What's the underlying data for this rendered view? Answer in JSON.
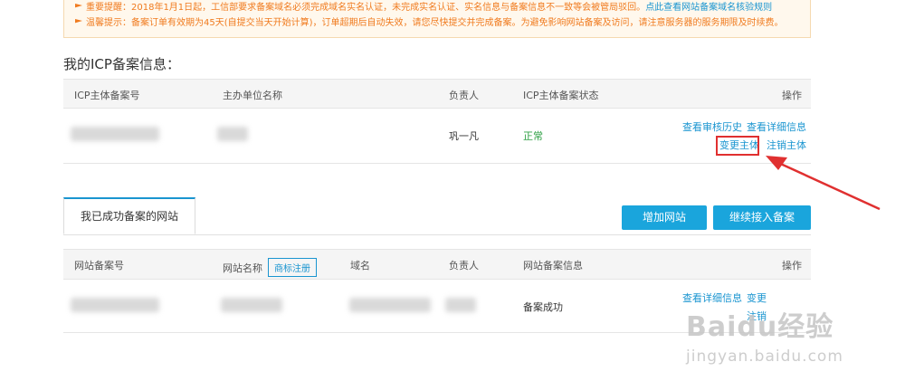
{
  "notice": {
    "line1_text": "重要提醒：2018年1月1日起，工信部要求备案域名必须完成域名实名认证，未完成实名认证、实名信息与备案信息不一致等会被管局驳回。",
    "line1_link": "点此查看网站备案域名核验规则",
    "line2_text": "温馨提示：备案订单有效期为45天(自提交当天开始计算)，订单超期后自动失效，请您尽快提交并完成备案。为避免影响网站备案及访问，请注意服务器的服务期限及时续费。"
  },
  "icp_section": {
    "title": "我的ICP备案信息：",
    "headers": {
      "record_no": "ICP主体备案号",
      "organizer": "主办单位名称",
      "owner": "负责人",
      "status": "ICP主体备案状态",
      "actions": "操作"
    },
    "row": {
      "owner": "巩一凡",
      "status": "正常",
      "actions": {
        "audit_history": "查看审核历史",
        "details": "查看详细信息",
        "change_subject": "变更主体",
        "cancel_subject": "注销主体"
      }
    }
  },
  "sites_section": {
    "tab_label": "我已成功备案的网站",
    "buttons": {
      "add_site": "增加网站",
      "continue": "继续接入备案"
    },
    "headers": {
      "record_no": "网站备案号",
      "site_name": "网站名称",
      "trademark": "商标注册",
      "domain": "域名",
      "owner": "负责人",
      "info": "网站备案信息",
      "actions": "操作"
    },
    "row": {
      "info": "备案成功",
      "actions": {
        "details": "查看详细信息",
        "change": "变更",
        "cancel": "注销"
      }
    }
  },
  "watermark": {
    "main": "Baidu经验",
    "sub": "jingyan.baidu.com"
  },
  "colors": {
    "link": "#1a95d0",
    "button": "#1aa5dc",
    "notice_text": "#f07b1f",
    "status_ok": "#2ea044",
    "highlight": "#e03030"
  }
}
